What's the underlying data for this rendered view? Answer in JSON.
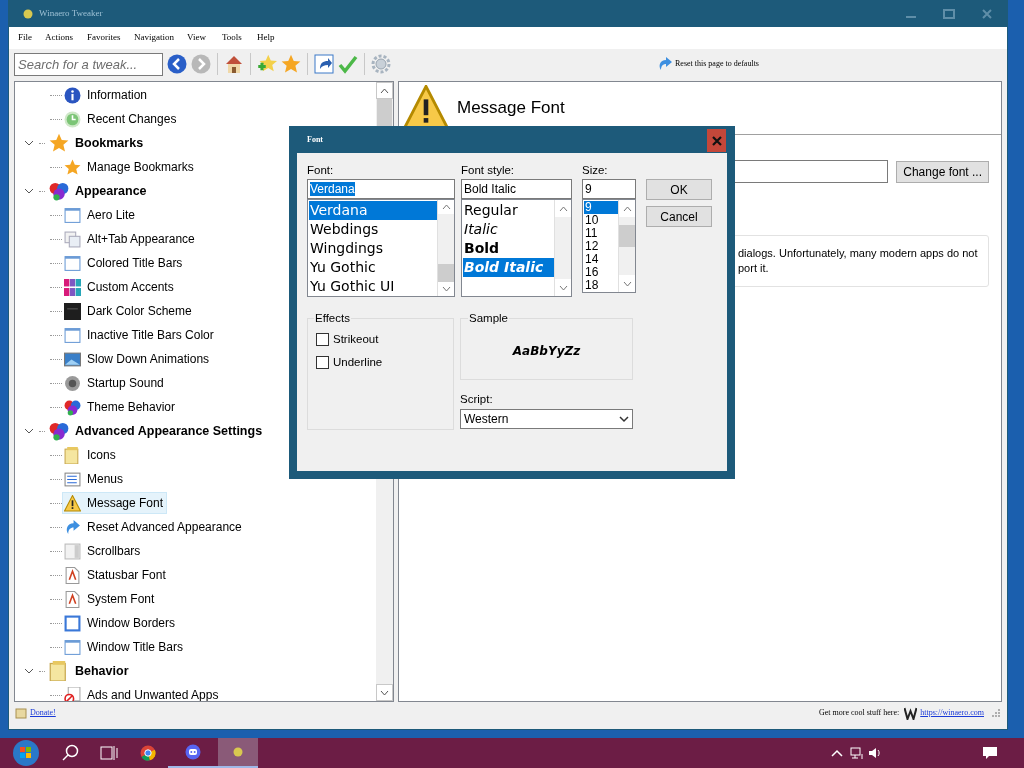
{
  "window": {
    "title": "Winaero Tweaker"
  },
  "menu": [
    "File",
    "Actions",
    "Favorites",
    "Navigation",
    "View",
    "Tools",
    "Help"
  ],
  "toolbar": {
    "search": {
      "placeholder": "Search for a tweak..."
    },
    "reset_link": "Reset this page to defaults"
  },
  "tree": [
    {
      "children": [
        {
          "label": "Information",
          "selected": false
        },
        {
          "label": "Recent Changes",
          "selected": false
        }
      ]
    },
    {
      "label": "Bookmarks",
      "expanded": true,
      "children": [
        {
          "label": "Manage Bookmarks",
          "selected": false
        }
      ]
    },
    {
      "label": "Appearance",
      "expanded": true,
      "children": [
        {
          "label": "Aero Lite",
          "selected": false
        },
        {
          "label": "Alt+Tab Appearance",
          "selected": false
        },
        {
          "label": "Colored Title Bars",
          "selected": false
        },
        {
          "label": "Custom Accents",
          "selected": false
        },
        {
          "label": "Dark Color Scheme",
          "selected": false
        },
        {
          "label": "Inactive Title Bars Color",
          "selected": false
        },
        {
          "label": "Slow Down Animations",
          "selected": false
        },
        {
          "label": "Startup Sound",
          "selected": false
        },
        {
          "label": "Theme Behavior",
          "selected": false
        }
      ]
    },
    {
      "label": "Advanced Appearance Settings",
      "expanded": true,
      "children": [
        {
          "label": "Icons",
          "selected": false
        },
        {
          "label": "Menus",
          "selected": false
        },
        {
          "label": "Message Font",
          "selected": true
        },
        {
          "label": "Reset Advanced Appearance",
          "selected": false
        },
        {
          "label": "Scrollbars",
          "selected": false
        },
        {
          "label": "Statusbar Font",
          "selected": false
        },
        {
          "label": "System Font",
          "selected": false
        },
        {
          "label": "Window Borders",
          "selected": false
        },
        {
          "label": "Window Title Bars",
          "selected": false
        }
      ]
    },
    {
      "label": "Behavior",
      "expanded": true,
      "children": [
        {
          "label": "Ads and Unwanted Apps",
          "selected": false
        }
      ]
    }
  ],
  "page": {
    "title": "Message Font",
    "change_button": "Change font ...",
    "description_lines": [
      "dialogs. Unfortunately, many modern apps do not",
      "port it."
    ]
  },
  "status_bar": {
    "donate": "Donate!",
    "promo": "Get more cool stuff here:",
    "link": "https://winaero.com"
  },
  "dialog": {
    "title": "Font",
    "font": {
      "label": "Font:",
      "value": "Verdana",
      "items": [
        {
          "label": "Verdana",
          "selected": true
        },
        {
          "label": "Webdings",
          "selected": false
        },
        {
          "label": "Wingdings",
          "selected": false
        },
        {
          "label": "Yu Gothic",
          "selected": false
        },
        {
          "label": "Yu Gothic UI",
          "selected": false
        }
      ]
    },
    "style": {
      "label": "Font style:",
      "value": "Bold Italic",
      "items": [
        {
          "label": "Regular",
          "kind": "regular",
          "selected": false
        },
        {
          "label": "Italic",
          "kind": "italic",
          "selected": false
        },
        {
          "label": "Bold",
          "kind": "bold",
          "selected": false
        },
        {
          "label": "Bold Italic",
          "kind": "bolditalic",
          "selected": true
        }
      ]
    },
    "size": {
      "label": "Size:",
      "value": "9",
      "items": [
        {
          "label": "9",
          "selected": true
        },
        {
          "label": "10",
          "selected": false
        },
        {
          "label": "11",
          "selected": false
        },
        {
          "label": "12",
          "selected": false
        },
        {
          "label": "14",
          "selected": false
        },
        {
          "label": "16",
          "selected": false
        },
        {
          "label": "18",
          "selected": false
        }
      ]
    },
    "buttons": [
      "OK",
      "Cancel"
    ],
    "effects": {
      "title": "Effects",
      "options": [
        {
          "label": "Strikeout",
          "checked": false
        },
        {
          "label": "Underline",
          "checked": false
        }
      ]
    },
    "sample": {
      "title": "Sample",
      "text": "AaBbYyZz"
    },
    "script": {
      "label": "Script:",
      "value": "Western"
    }
  }
}
